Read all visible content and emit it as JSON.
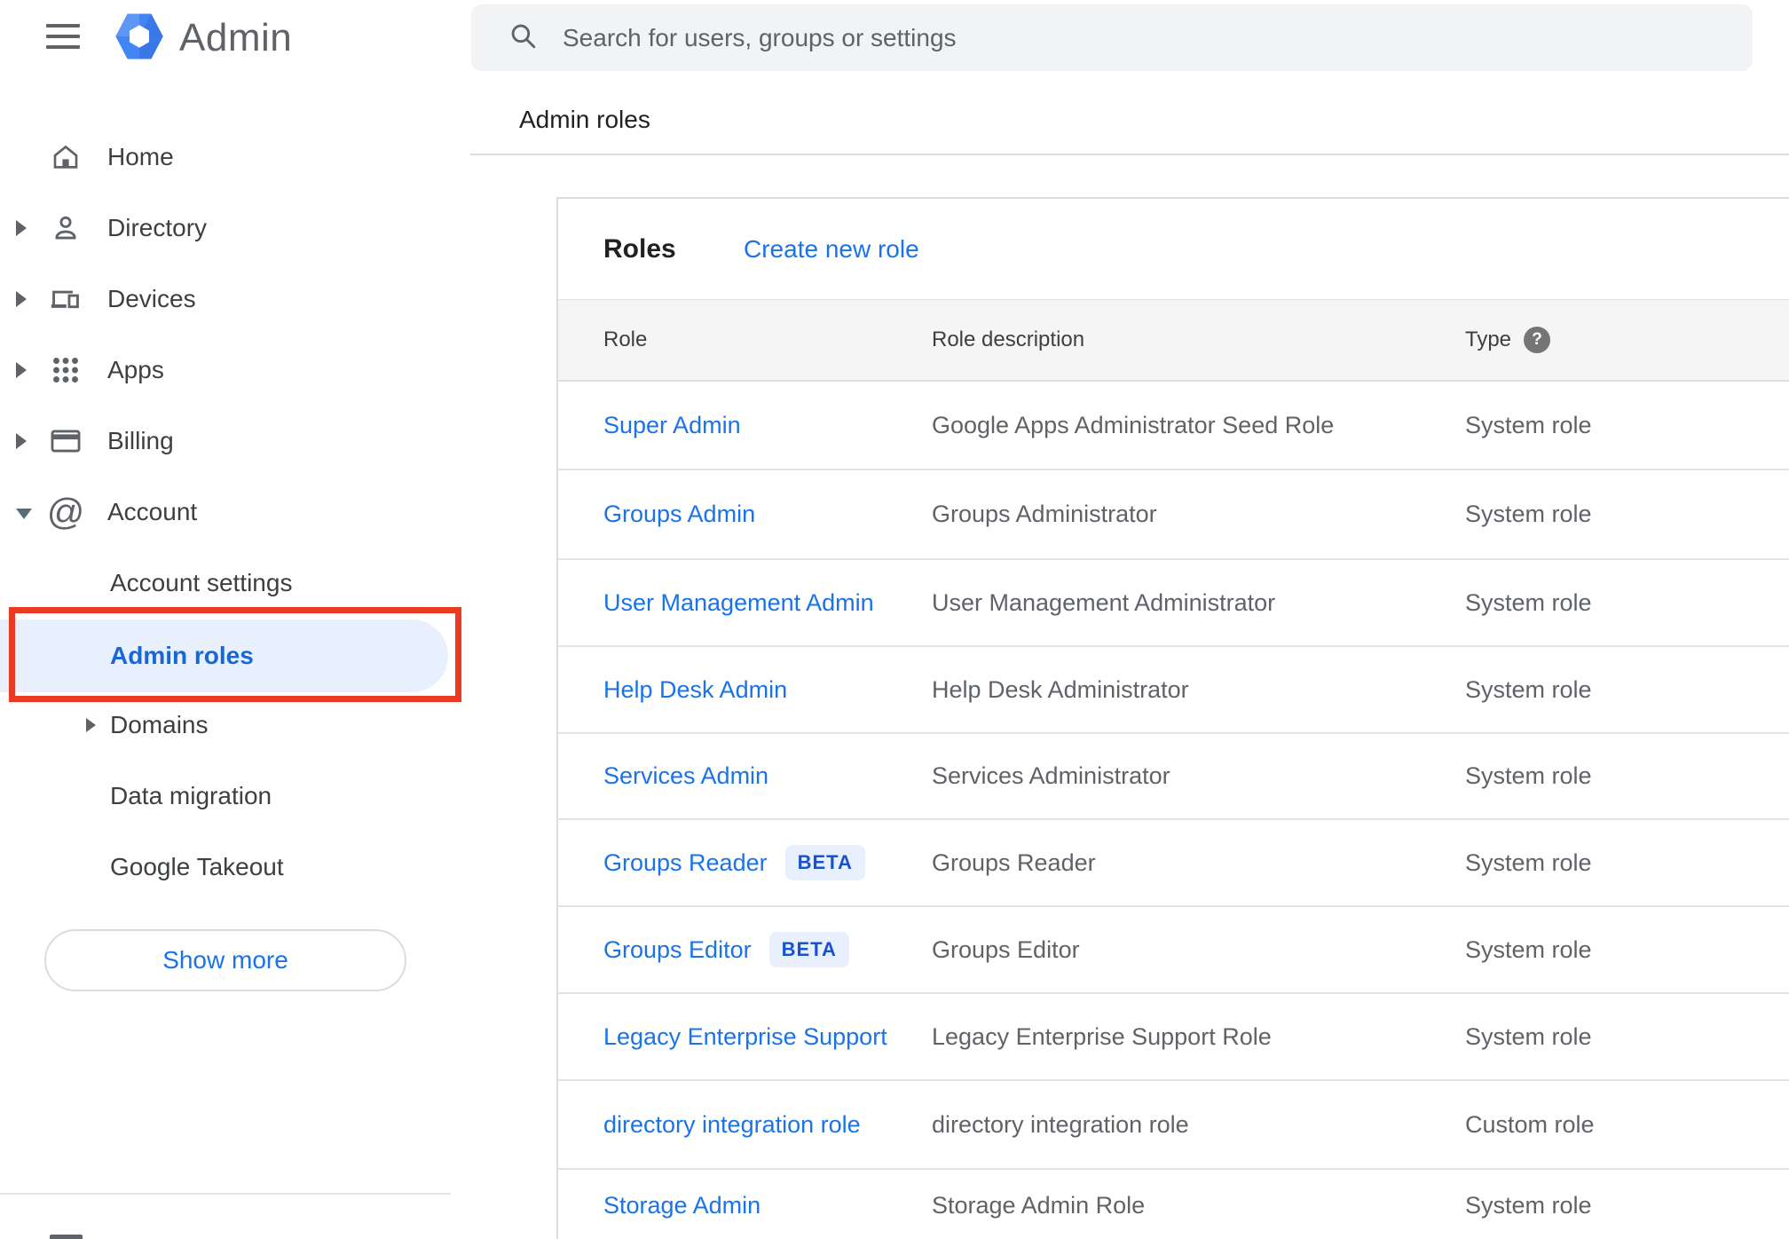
{
  "app": {
    "name": "Admin"
  },
  "search": {
    "placeholder": "Search for users, groups or settings"
  },
  "breadcrumb": "Admin roles",
  "sidebar": {
    "items": [
      {
        "label": "Home"
      },
      {
        "label": "Directory"
      },
      {
        "label": "Devices"
      },
      {
        "label": "Apps"
      },
      {
        "label": "Billing"
      },
      {
        "label": "Account"
      }
    ],
    "account_children": [
      {
        "label": "Account settings"
      },
      {
        "label": "Admin roles",
        "selected": true
      },
      {
        "label": "Domains"
      },
      {
        "label": "Data migration"
      },
      {
        "label": "Google Takeout"
      }
    ],
    "show_more_label": "Show more"
  },
  "roles_panel": {
    "title": "Roles",
    "create_link": "Create new role",
    "columns": [
      "Role",
      "Role description",
      "Type"
    ],
    "rows": [
      {
        "role": "Super Admin",
        "description": "Google Apps Administrator Seed Role",
        "type": "System role"
      },
      {
        "role": "Groups Admin",
        "description": "Groups Administrator",
        "type": "System role"
      },
      {
        "role": "User Management Admin",
        "description": "User Management Administrator",
        "type": "System role"
      },
      {
        "role": "Help Desk Admin",
        "description": "Help Desk Administrator",
        "type": "System role"
      },
      {
        "role": "Services Admin",
        "description": "Services Administrator",
        "type": "System role"
      },
      {
        "role": "Groups Reader",
        "beta_label": "BETA",
        "description": "Groups Reader",
        "type": "System role"
      },
      {
        "role": "Groups Editor",
        "beta_label": "BETA",
        "description": "Groups Editor",
        "type": "System role"
      },
      {
        "role": "Legacy Enterprise Support",
        "description": "Legacy Enterprise Support Role",
        "type": "System role"
      },
      {
        "role": "directory integration role",
        "description": "directory integration role",
        "type": "Custom role"
      },
      {
        "role": "Storage Admin",
        "description": "Storage Admin Role",
        "type": "System role"
      }
    ],
    "help_icon_glyph": "?"
  },
  "colors": {
    "link_blue": "#1a73e8",
    "selected_nav_blue": "#1967d2",
    "selected_nav_bg": "#e8f0fe",
    "annotation_red": "#ea3a23",
    "search_bg": "#f1f3f4",
    "table_header_bg": "#f5f5f5"
  }
}
